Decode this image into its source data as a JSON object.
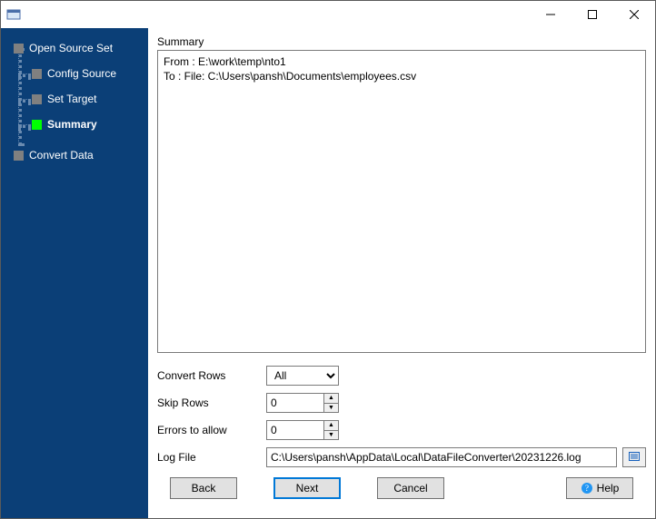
{
  "titlebar": {
    "title": ""
  },
  "sidebar": {
    "items": [
      {
        "label": "Open Source Set",
        "active": false
      },
      {
        "label": "Config Source",
        "active": false
      },
      {
        "label": "Set Target",
        "active": false
      },
      {
        "label": "Summary",
        "active": true
      },
      {
        "label": "Convert Data",
        "active": false
      }
    ]
  },
  "main": {
    "section_label": "Summary",
    "summary_lines": [
      "From : E:\\work\\temp\\nto1",
      "To : File: C:\\Users\\pansh\\Documents\\employees.csv"
    ],
    "convert_rows": {
      "label": "Convert Rows",
      "selected": "All",
      "options": [
        "All"
      ]
    },
    "skip_rows": {
      "label": "Skip Rows",
      "value": "0"
    },
    "errors_allow": {
      "label": "Errors to allow",
      "value": "0"
    },
    "log_file": {
      "label": "Log File",
      "value": "C:\\Users\\pansh\\AppData\\Local\\DataFileConverter\\20231226.log"
    }
  },
  "footer": {
    "back": "Back",
    "next": "Next",
    "cancel": "Cancel",
    "help": "Help"
  }
}
